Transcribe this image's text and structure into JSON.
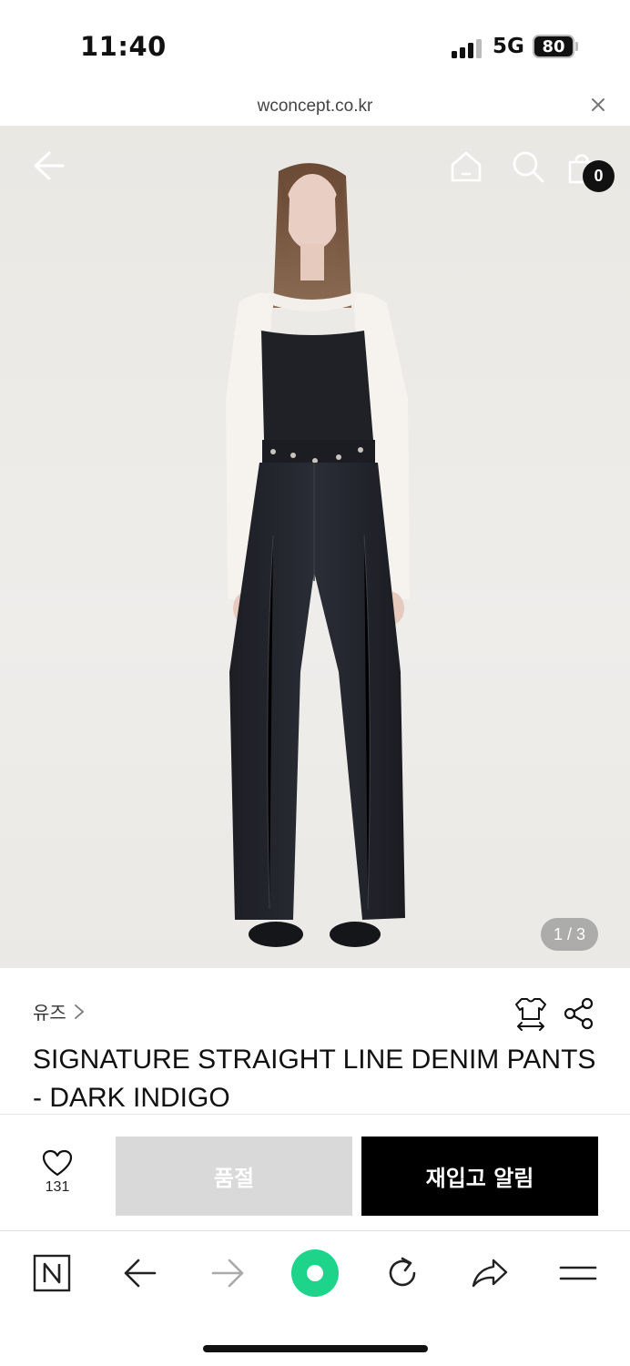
{
  "status_bar": {
    "time": "11:40",
    "network": "5G",
    "battery": "80"
  },
  "url_bar": {
    "domain": "wconcept.co.kr"
  },
  "hero": {
    "cart_count": "0",
    "page_indicator": "1 / 3",
    "icons": [
      "back-arrow-icon",
      "home-icon",
      "search-icon",
      "shopping-bag-icon"
    ]
  },
  "product": {
    "brand": "유즈",
    "title": "SIGNATURE STRAIGHT LINE DENIM PANTS - DARK INDIGO"
  },
  "actions": {
    "wish_count": "131",
    "soldout_label": "품절",
    "restock_label": "재입고 알림"
  },
  "browser_toolbar": {
    "icons": [
      "naver-n-icon",
      "back-icon",
      "forward-icon",
      "green-home-icon",
      "reload-icon",
      "share-icon",
      "menu-icon"
    ]
  },
  "colors": {
    "accent_green": "#1ed38a",
    "button_dark": "#000000",
    "button_disabled": "#d9d9d9"
  }
}
